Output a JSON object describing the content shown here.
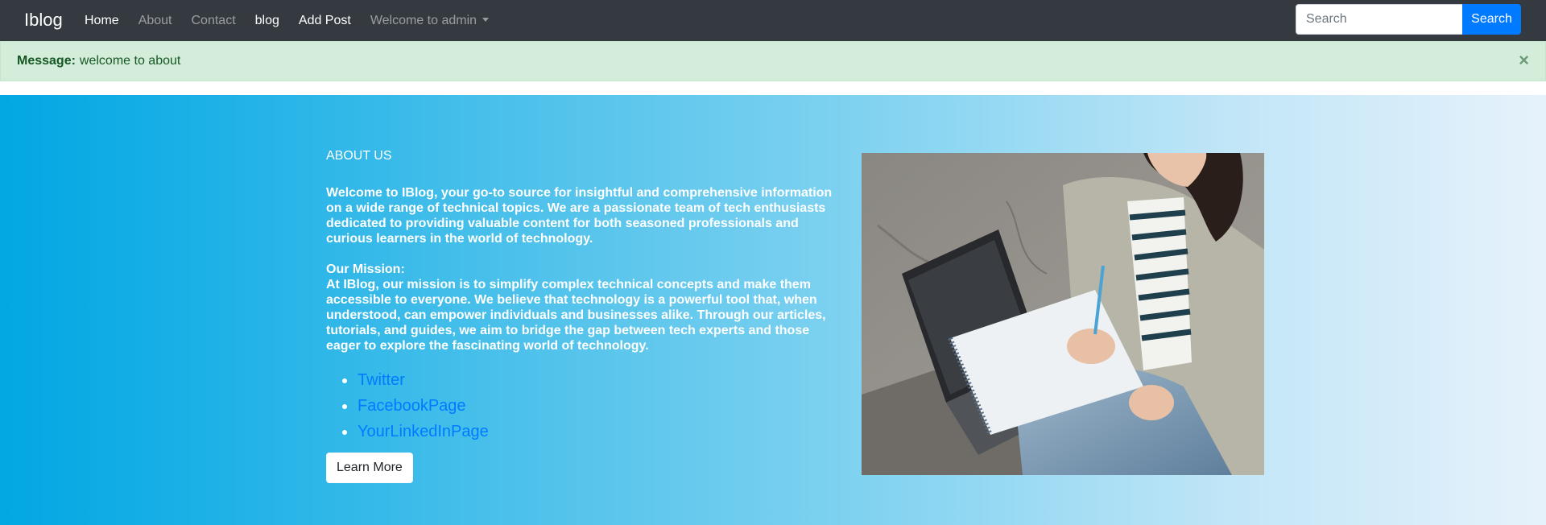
{
  "navbar": {
    "brand": "Iblog",
    "links": [
      {
        "label": "Home",
        "active": true
      },
      {
        "label": "About",
        "active": false
      },
      {
        "label": "Contact",
        "active": false
      },
      {
        "label": "blog",
        "active": true
      },
      {
        "label": "Add Post",
        "active": true
      }
    ],
    "dropdown_label": "Welcome to admin",
    "search_placeholder": "Search",
    "search_button": "Search"
  },
  "alert": {
    "label": "Message:",
    "text": "welcome to about",
    "close": "×"
  },
  "about": {
    "heading": "ABOUT US",
    "intro": "Welcome to IBlog, your go-to source for insightful and comprehensive information on a wide range of technical topics. We are a passionate team of tech enthusiasts dedicated to providing valuable content for both seasoned professionals and curious learners in the world of technology.",
    "mission_title": "Our Mission:",
    "mission_text": "At IBlog, our mission is to simplify complex technical concepts and make them accessible to everyone. We believe that technology is a powerful tool that, when understood, can empower individuals and businesses alike. Through our articles, tutorials, and guides, we aim to bridge the gap between tech experts and those eager to explore the fascinating world of technology.",
    "social_links": [
      "Twitter",
      "FacebookPage",
      "YourLinkedInPage"
    ],
    "button": "Learn More"
  },
  "colors": {
    "navbar_bg": "#343a40",
    "alert_bg": "#d4edda",
    "alert_text": "#155724",
    "primary": "#007bff",
    "hero_start": "#02a7e3",
    "hero_end": "#e6f2fb"
  }
}
